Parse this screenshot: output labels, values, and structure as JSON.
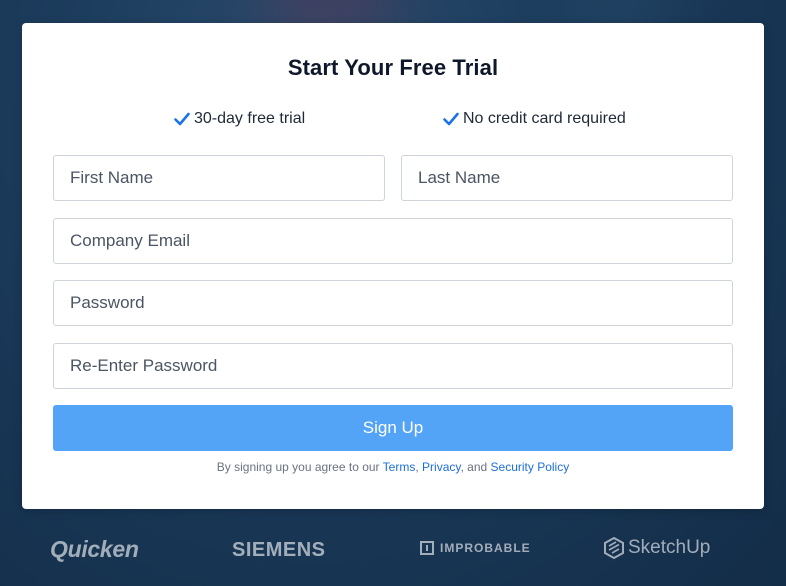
{
  "form": {
    "title": "Start Your Free Trial",
    "perks": [
      {
        "label": "30-day free trial",
        "icon": "checkmark-icon"
      },
      {
        "label": "No credit card required",
        "icon": "checkmark-icon"
      }
    ],
    "fields": {
      "first_name": {
        "placeholder": "First Name",
        "value": ""
      },
      "last_name": {
        "placeholder": "Last Name",
        "value": ""
      },
      "company_email": {
        "placeholder": "Company Email",
        "value": ""
      },
      "password": {
        "placeholder": "Password",
        "value": ""
      },
      "reenter_password": {
        "placeholder": "Re-Enter Password",
        "value": ""
      }
    },
    "submit_label": "Sign Up",
    "legal": {
      "prefix": "By signing up you agree to our",
      "terms": "Terms",
      "comma": ",",
      "privacy": "Privacy",
      "and": ", and",
      "security": "Security Policy"
    }
  },
  "logos": [
    {
      "name": "Quicken"
    },
    {
      "name": "SIEMENS"
    },
    {
      "name": "IMPROBABLE"
    },
    {
      "name": "SketchUp"
    }
  ],
  "colors": {
    "accent": "#53a3f7",
    "check": "#1a73e8",
    "link": "#1d6fd8",
    "background": "#1d3d5e"
  }
}
